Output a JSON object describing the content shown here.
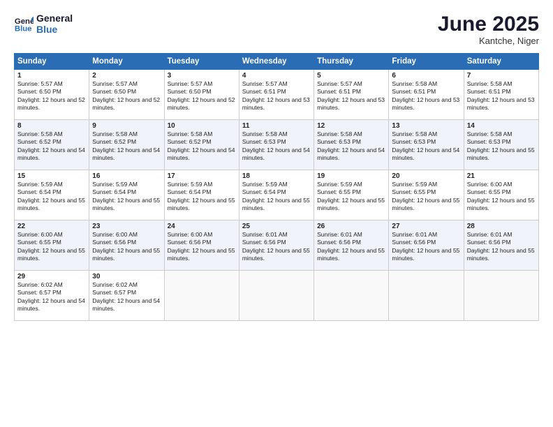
{
  "header": {
    "logo_line1": "General",
    "logo_line2": "Blue",
    "month": "June 2025",
    "location": "Kantche, Niger"
  },
  "days_of_week": [
    "Sunday",
    "Monday",
    "Tuesday",
    "Wednesday",
    "Thursday",
    "Friday",
    "Saturday"
  ],
  "weeks": [
    [
      {
        "day": 1,
        "sunrise": "5:57 AM",
        "sunset": "6:50 PM",
        "daylight": "12 hours and 52 minutes."
      },
      {
        "day": 2,
        "sunrise": "5:57 AM",
        "sunset": "6:50 PM",
        "daylight": "12 hours and 52 minutes."
      },
      {
        "day": 3,
        "sunrise": "5:57 AM",
        "sunset": "6:50 PM",
        "daylight": "12 hours and 52 minutes."
      },
      {
        "day": 4,
        "sunrise": "5:57 AM",
        "sunset": "6:51 PM",
        "daylight": "12 hours and 53 minutes."
      },
      {
        "day": 5,
        "sunrise": "5:57 AM",
        "sunset": "6:51 PM",
        "daylight": "12 hours and 53 minutes."
      },
      {
        "day": 6,
        "sunrise": "5:58 AM",
        "sunset": "6:51 PM",
        "daylight": "12 hours and 53 minutes."
      },
      {
        "day": 7,
        "sunrise": "5:58 AM",
        "sunset": "6:51 PM",
        "daylight": "12 hours and 53 minutes."
      }
    ],
    [
      {
        "day": 8,
        "sunrise": "5:58 AM",
        "sunset": "6:52 PM",
        "daylight": "12 hours and 54 minutes."
      },
      {
        "day": 9,
        "sunrise": "5:58 AM",
        "sunset": "6:52 PM",
        "daylight": "12 hours and 54 minutes."
      },
      {
        "day": 10,
        "sunrise": "5:58 AM",
        "sunset": "6:52 PM",
        "daylight": "12 hours and 54 minutes."
      },
      {
        "day": 11,
        "sunrise": "5:58 AM",
        "sunset": "6:53 PM",
        "daylight": "12 hours and 54 minutes."
      },
      {
        "day": 12,
        "sunrise": "5:58 AM",
        "sunset": "6:53 PM",
        "daylight": "12 hours and 54 minutes."
      },
      {
        "day": 13,
        "sunrise": "5:58 AM",
        "sunset": "6:53 PM",
        "daylight": "12 hours and 54 minutes."
      },
      {
        "day": 14,
        "sunrise": "5:58 AM",
        "sunset": "6:53 PM",
        "daylight": "12 hours and 55 minutes."
      }
    ],
    [
      {
        "day": 15,
        "sunrise": "5:59 AM",
        "sunset": "6:54 PM",
        "daylight": "12 hours and 55 minutes."
      },
      {
        "day": 16,
        "sunrise": "5:59 AM",
        "sunset": "6:54 PM",
        "daylight": "12 hours and 55 minutes."
      },
      {
        "day": 17,
        "sunrise": "5:59 AM",
        "sunset": "6:54 PM",
        "daylight": "12 hours and 55 minutes."
      },
      {
        "day": 18,
        "sunrise": "5:59 AM",
        "sunset": "6:54 PM",
        "daylight": "12 hours and 55 minutes."
      },
      {
        "day": 19,
        "sunrise": "5:59 AM",
        "sunset": "6:55 PM",
        "daylight": "12 hours and 55 minutes."
      },
      {
        "day": 20,
        "sunrise": "5:59 AM",
        "sunset": "6:55 PM",
        "daylight": "12 hours and 55 minutes."
      },
      {
        "day": 21,
        "sunrise": "6:00 AM",
        "sunset": "6:55 PM",
        "daylight": "12 hours and 55 minutes."
      }
    ],
    [
      {
        "day": 22,
        "sunrise": "6:00 AM",
        "sunset": "6:55 PM",
        "daylight": "12 hours and 55 minutes."
      },
      {
        "day": 23,
        "sunrise": "6:00 AM",
        "sunset": "6:56 PM",
        "daylight": "12 hours and 55 minutes."
      },
      {
        "day": 24,
        "sunrise": "6:00 AM",
        "sunset": "6:56 PM",
        "daylight": "12 hours and 55 minutes."
      },
      {
        "day": 25,
        "sunrise": "6:01 AM",
        "sunset": "6:56 PM",
        "daylight": "12 hours and 55 minutes."
      },
      {
        "day": 26,
        "sunrise": "6:01 AM",
        "sunset": "6:56 PM",
        "daylight": "12 hours and 55 minutes."
      },
      {
        "day": 27,
        "sunrise": "6:01 AM",
        "sunset": "6:56 PM",
        "daylight": "12 hours and 55 minutes."
      },
      {
        "day": 28,
        "sunrise": "6:01 AM",
        "sunset": "6:56 PM",
        "daylight": "12 hours and 55 minutes."
      }
    ],
    [
      {
        "day": 29,
        "sunrise": "6:02 AM",
        "sunset": "6:57 PM",
        "daylight": "12 hours and 54 minutes."
      },
      {
        "day": 30,
        "sunrise": "6:02 AM",
        "sunset": "6:57 PM",
        "daylight": "12 hours and 54 minutes."
      },
      null,
      null,
      null,
      null,
      null
    ]
  ]
}
